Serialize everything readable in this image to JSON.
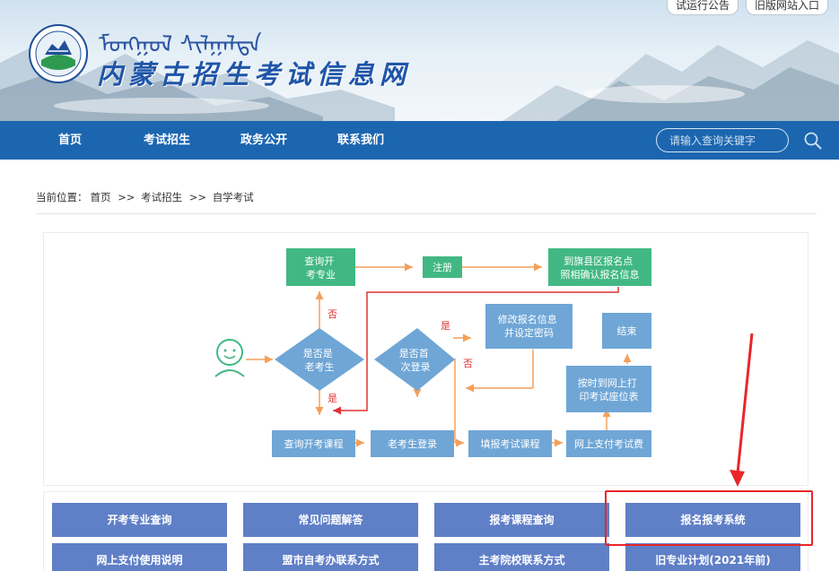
{
  "header": {
    "top_links": [
      "试运行公告",
      "旧版网站入口"
    ],
    "mongolian_script": "ᠮᠣᠩᠭᠣᠯ ᠰᠢᠯᠭᠠᠯᠲᠠ",
    "site_title": "内蒙古招生考试信息网"
  },
  "nav": {
    "items": [
      "首页",
      "考试招生",
      "政务公开",
      "联系我们"
    ],
    "search_placeholder": "请输入查询关键字"
  },
  "breadcrumb": {
    "prefix": "当前位置：",
    "items": [
      "首页",
      "考试招生",
      "自学考试"
    ],
    "separator": ">>"
  },
  "flowchart": {
    "nodes": {
      "query_major": "查询开|考专业",
      "register": "注册",
      "confirm_info": "到旗县区报名点|照相确认报名信息",
      "is_old": "是否是|老考生",
      "is_first": "是否首|次登录",
      "modify_info": "修改报名信息|并设定密码",
      "end": "结束",
      "print_ticket": "按时到网上打|印考试座位表",
      "query_course": "查询开考课程",
      "old_login": "老考生登录",
      "fill_course": "填报考试课程",
      "pay_online": "网上支付考试费"
    },
    "labels": {
      "no": "否",
      "yes": "是"
    },
    "colors": {
      "green": "#41b883",
      "blue": "#6fa6d6",
      "orange": "#f4a05a",
      "red": "#e03434"
    }
  },
  "buttons": {
    "row1": [
      "开考专业查询",
      "常见问题解答",
      "报考课程查询",
      "报名报考系统"
    ],
    "row2": [
      "网上支付使用说明",
      "盟市自考办联系方式",
      "主考院校联系方式",
      "旧专业计划(2021年前)"
    ]
  },
  "colors": {
    "nav": "#1c66b0",
    "button": "#5f7fc7",
    "annotation": "#e8262a"
  }
}
